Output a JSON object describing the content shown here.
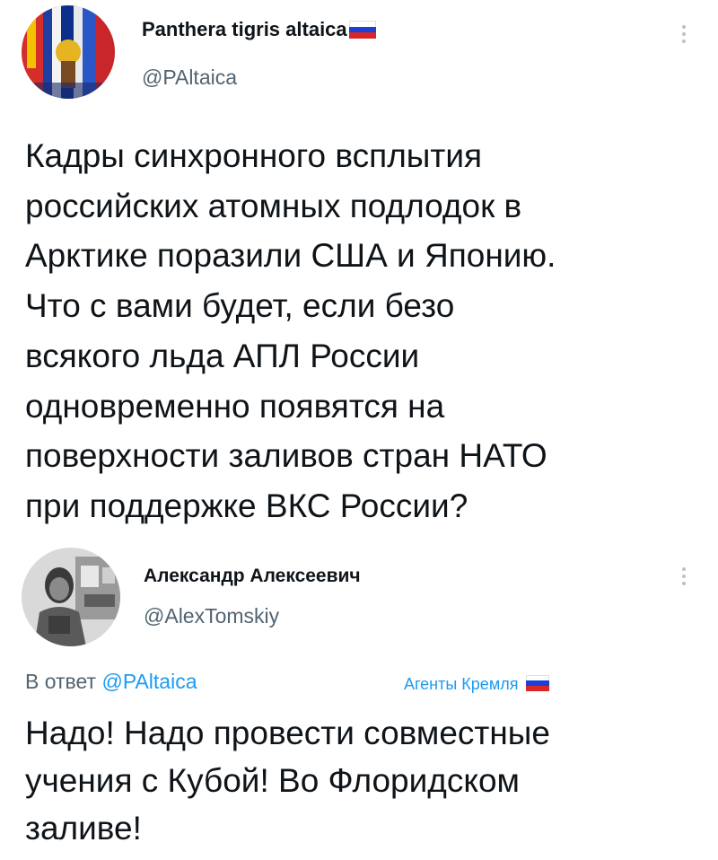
{
  "colors": {
    "link": "#1d9bf0",
    "secondary_text": "#536471",
    "primary_text": "#0f1419"
  },
  "tweet": {
    "author_name": "Panthera tigris altaica",
    "author_handle": "@PAltaica",
    "name_suffix_icon": "russian-flag-icon",
    "text": "Кадры синхронного всплытия\nроссийских атомных подлодок в\nАрктике поразили США и Японию.\nЧто с вами будет, если безо\nвсякого льда АПЛ России\nодновременно появятся на\nповерхности заливов стран НАТО\nпри поддержке ВКС России?"
  },
  "reply": {
    "author_name": "Александр Алексеевич",
    "author_handle": "@AlexTomskiy",
    "reply_prefix": "В ответ",
    "reply_to": "@PAltaica",
    "tag_label": "Агенты Кремля",
    "tag_icon": "russian-flag-icon",
    "text": "Надо! Надо провести совместные\nучения с Кубой! Во Флоридском\nзаливе!"
  }
}
